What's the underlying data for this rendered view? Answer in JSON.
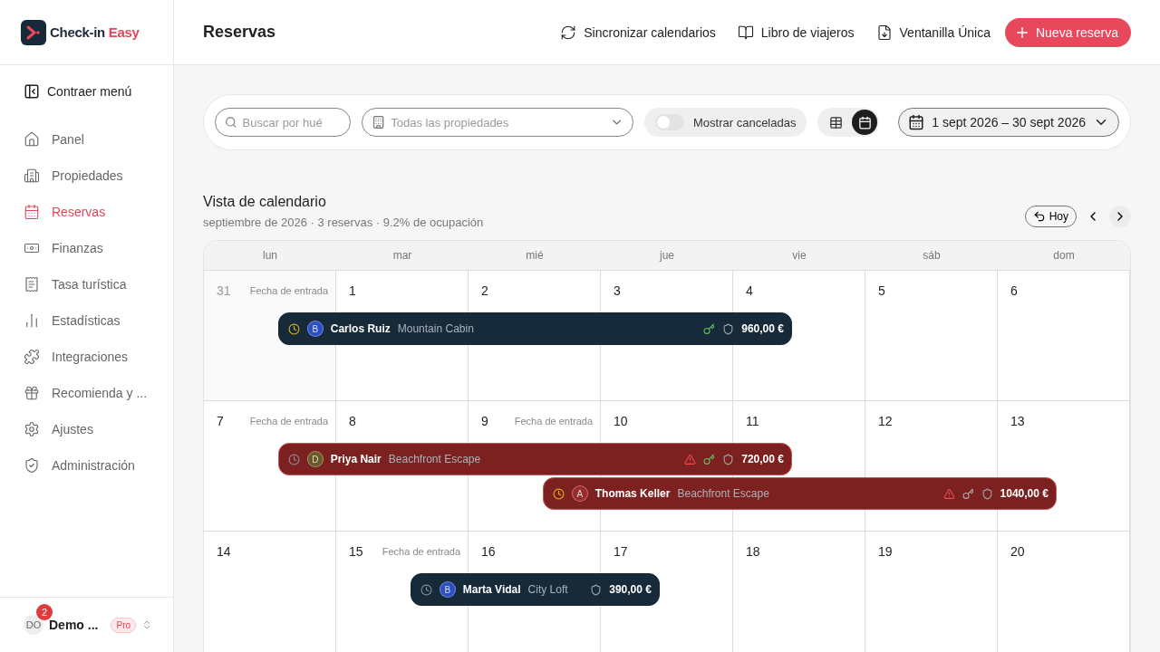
{
  "brand": {
    "name": "Check-in",
    "accent": "Easy"
  },
  "sidebar": {
    "collapse": "Contraer menú",
    "items": [
      {
        "label": "Panel",
        "selected": false
      },
      {
        "label": "Propiedades",
        "selected": false
      },
      {
        "label": "Reservas",
        "selected": true
      },
      {
        "label": "Finanzas",
        "selected": false
      },
      {
        "label": "Tasa turística",
        "selected": false
      },
      {
        "label": "Estadísticas",
        "selected": false
      },
      {
        "label": "Integraciones",
        "selected": false
      },
      {
        "label": "Recomienda y ...",
        "selected": false
      },
      {
        "label": "Ajustes",
        "selected": false
      },
      {
        "label": "Administración",
        "selected": false
      }
    ],
    "user": {
      "initials": "DO",
      "name": "Demo ...",
      "badge": "2",
      "plan": "Pro"
    }
  },
  "header": {
    "title": "Reservas",
    "actions": [
      "Sincronizar calendarios",
      "Libro de viajeros",
      "Ventanilla Única"
    ],
    "primary": "Nueva reserva"
  },
  "filters": {
    "search": {
      "placeholder": "Buscar por hué"
    },
    "property": {
      "placeholder": "Todas las propiedades"
    },
    "show_cancelled": {
      "label": "Mostrar canceladas",
      "on": false
    },
    "views": [
      {
        "kind": "table",
        "selected": false
      },
      {
        "kind": "calendar",
        "selected": true
      }
    ],
    "date_range": "1 sept 2026 – 30 sept 2026"
  },
  "calendar": {
    "title": "Vista de calendario",
    "subtitle": "septiembre de 2026 · 3 reservas · 9.2% de ocupación",
    "today": "Hoy",
    "weekdays": [
      "lun",
      "mar",
      "mié",
      "jue",
      "vie",
      "sáb",
      "dom"
    ],
    "weeks": [
      {
        "days": [
          {
            "day": "31",
            "outside": true,
            "checkin": "Fecha de entrada"
          },
          {
            "day": "1",
            "outside": false
          },
          {
            "day": "2",
            "outside": false
          },
          {
            "day": "3",
            "outside": false
          },
          {
            "day": "4",
            "outside": false
          },
          {
            "day": "5",
            "outside": false
          },
          {
            "day": "6",
            "outside": false
          }
        ],
        "bookings": [
          {
            "kind": "normal",
            "clock_active": true,
            "avatar": "B",
            "color": "#2d4fc4",
            "guest": "Carlos Ruiz",
            "property": "Mountain Cabin",
            "warning": false,
            "key_done": true,
            "price": "960,00 €"
          }
        ]
      },
      {
        "days": [
          {
            "day": "7",
            "outside": false,
            "checkin": "Fecha de entrada"
          },
          {
            "day": "8",
            "outside": false
          },
          {
            "day": "9",
            "outside": false,
            "checkin": "Fecha de entrada"
          },
          {
            "day": "10",
            "outside": false
          },
          {
            "day": "11",
            "outside": false
          },
          {
            "day": "12",
            "outside": false
          },
          {
            "day": "13",
            "outside": false
          }
        ],
        "bookings": [
          {
            "kind": "alert",
            "clock_active": false,
            "avatar": "D",
            "color": "#6b5a26",
            "guest": "Priya Nair",
            "property": "Beachfront Escape",
            "warning": true,
            "key_done": true,
            "price": "720,00 €"
          },
          {
            "kind": "alert",
            "clock_active": true,
            "avatar": "A",
            "color": "#9c2a2a",
            "guest": "Thomas Keller",
            "property": "Beachfront Escape",
            "warning": true,
            "key_done": false,
            "price": "1040,00 €"
          }
        ]
      },
      {
        "days": [
          {
            "day": "14",
            "outside": false
          },
          {
            "day": "15",
            "outside": false,
            "checkin": "Fecha de entrada"
          },
          {
            "day": "16",
            "outside": false
          },
          {
            "day": "17",
            "outside": false
          },
          {
            "day": "18",
            "outside": false
          },
          {
            "day": "19",
            "outside": false
          },
          {
            "day": "20",
            "outside": false
          }
        ],
        "bookings": [
          {
            "kind": "normal",
            "clock_active": false,
            "avatar": "B",
            "color": "#2d4fc4",
            "guest": "Marta Vidal",
            "property": "City Loft",
            "warning": false,
            "price": "390,00 €"
          }
        ]
      }
    ]
  }
}
